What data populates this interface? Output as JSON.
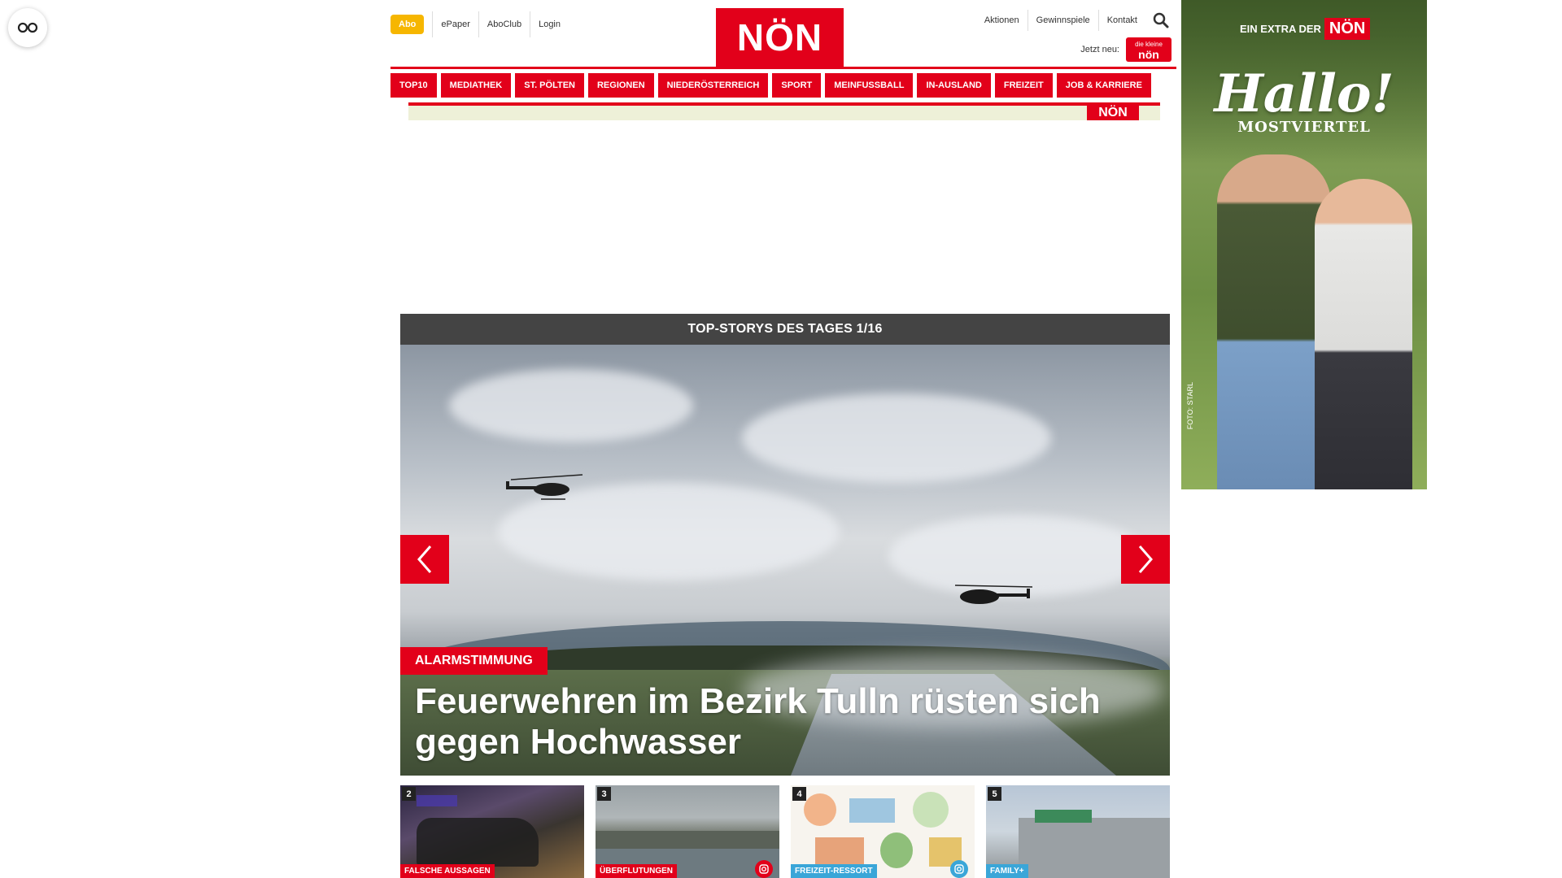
{
  "accessibility": {
    "icon": "accessibility-glasses-icon"
  },
  "header": {
    "abo_label": "Abo",
    "top_links": [
      "ePaper",
      "AboClub",
      "Login"
    ],
    "logo_text": "NÖN",
    "right_links": [
      "Aktionen",
      "Gewinnspiele",
      "Kontakt"
    ],
    "search_icon": "search-icon",
    "jetzt_label": "Jetzt neu:",
    "kleine_logo": {
      "top": "die kleine",
      "main": "nön"
    }
  },
  "nav": {
    "items": [
      "TOP10",
      "MEDIATHEK",
      "ST. PÖLTEN",
      "REGIONEN",
      "NIEDERÖSTERREICH",
      "SPORT",
      "MEINFUSSBALL",
      "IN-AUSLAND",
      "FREIZEIT",
      "JOB & KARRIERE"
    ]
  },
  "ad_strip": {
    "logo": "NÖN"
  },
  "slider": {
    "heading": "TOP-STORYS DES TAGES 1/16",
    "tag": "ALARMSTIMMUNG",
    "title": "Feuerwehren im Bezirk Tulln rüsten sich gegen Hochwasser",
    "prev_icon": "chevron-left-icon",
    "next_icon": "chevron-right-icon"
  },
  "thumbs": [
    {
      "num": "2",
      "tag": "FALSCHE AUSSAGEN",
      "tag_color": "#e2001a",
      "photo_icon": false
    },
    {
      "num": "3",
      "tag": "ÜBERFLUTUNGEN",
      "tag_color": "#e2001a",
      "photo_icon": true,
      "photo_icon_color": "#e2001a"
    },
    {
      "num": "4",
      "tag": "FREIZEIT-RESSORT",
      "tag_color": "#3aa6d8",
      "photo_icon": true,
      "photo_icon_color": "#3aa6d8"
    },
    {
      "num": "5",
      "tag": "FAMILY+",
      "tag_color": "#3aa6d8",
      "photo_icon": false
    }
  ],
  "side_ad": {
    "extra_label": "EIN EXTRA DER",
    "logo": "NÖN",
    "hallo": "Hallo!",
    "region": "MOSTVIERTEL",
    "credit": "FOTO: STARL"
  },
  "colors": {
    "brand_red": "#e2001a",
    "abo_yellow": "#f6b600",
    "slider_head": "#444444"
  }
}
